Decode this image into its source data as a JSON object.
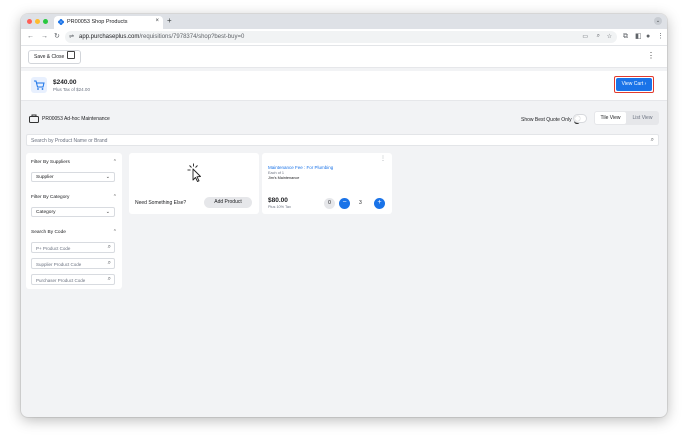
{
  "browser": {
    "tab_title": "PR00053 Shop Products",
    "tab_close": "×",
    "new_tab": "+",
    "url_domain": "app.purchaseplus.com",
    "url_path": "/requisitions/7978374/shop?best-buy=0"
  },
  "toolbar": {
    "save_close_label": "Save & Close"
  },
  "cart": {
    "total": "$240.00",
    "tax": "Plus Tax of $24.00",
    "view_cart_label": "View Cart"
  },
  "requisition": {
    "title": "PR00053 Ad-hoc Maintenance",
    "best_quote_label": "Show Best Quote Only",
    "best_quote_enabled": false,
    "view_options": [
      "Tile View",
      "List View"
    ],
    "active_view": "Tile View"
  },
  "search": {
    "placeholder": "Search by Product Name or Brand"
  },
  "filters": {
    "suppliers_heading": "Filter By Suppliers",
    "supplier_value": "Supplier",
    "category_heading": "Filter By Category",
    "category_value": "Category",
    "code_heading": "Search By Code",
    "code_fields": [
      "P+ Product Code",
      "Supplier Product Code",
      "Purchaser Product Code"
    ]
  },
  "add_card": {
    "prompt": "Need Something Else?",
    "button": "Add Product",
    "icon": "cursor-click-icon"
  },
  "products": [
    {
      "name": "Maintenance Fee : For Plumbing",
      "unit": "Each of 1",
      "supplier": "Jim's Maintenance",
      "price": "$80.00",
      "tax": "Plus 10% Tax",
      "badge": "0",
      "quantity": "3"
    }
  ],
  "colors": {
    "accent": "#1a73e8",
    "highlight": "#e23a2d",
    "background": "#f2f3f5"
  }
}
